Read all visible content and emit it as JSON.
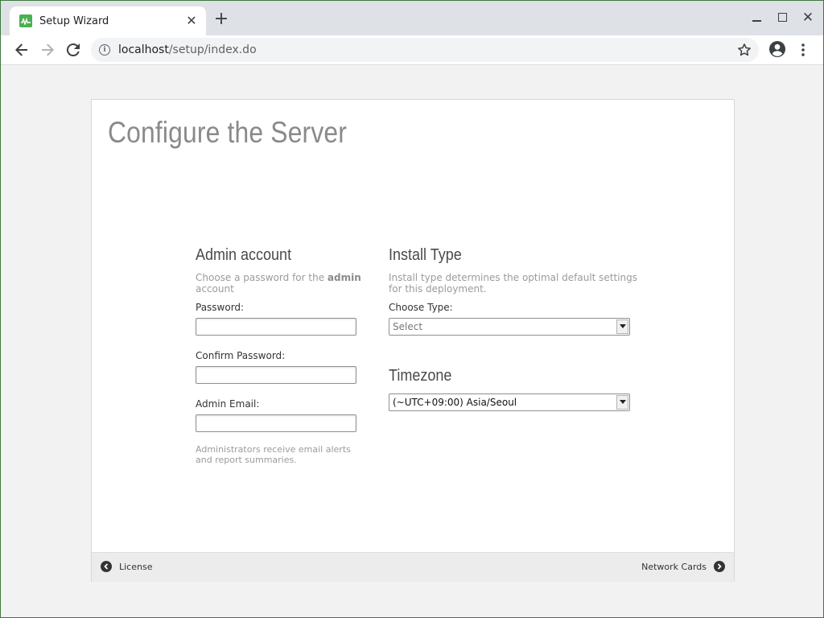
{
  "browser": {
    "tab_title": "Setup Wizard",
    "url_host": "localhost",
    "url_path": "/setup/index.do",
    "icons": [
      "back-icon",
      "forward-icon",
      "reload-icon",
      "info-icon",
      "star-icon",
      "account-icon",
      "menu-icon"
    ]
  },
  "page": {
    "title": "Configure the Server"
  },
  "admin": {
    "heading": "Admin account",
    "desc_prefix": "Choose a password for the ",
    "desc_bold": "admin",
    "desc_suffix": " account",
    "password_label": "Password:",
    "password_value": "",
    "confirm_label": "Confirm Password:",
    "confirm_value": "",
    "email_label": "Admin Email:",
    "email_value": "",
    "email_help": "Administrators receive email alerts and report summaries."
  },
  "install": {
    "heading": "Install Type",
    "desc": "Install type determines the optimal default settings for this deployment.",
    "type_label": "Choose Type:",
    "type_selected": "Select"
  },
  "timezone": {
    "heading": "Timezone",
    "selected": "(~UTC+09:00) Asia/Seoul"
  },
  "footer": {
    "prev_label": "License",
    "next_label": "Network Cards"
  }
}
